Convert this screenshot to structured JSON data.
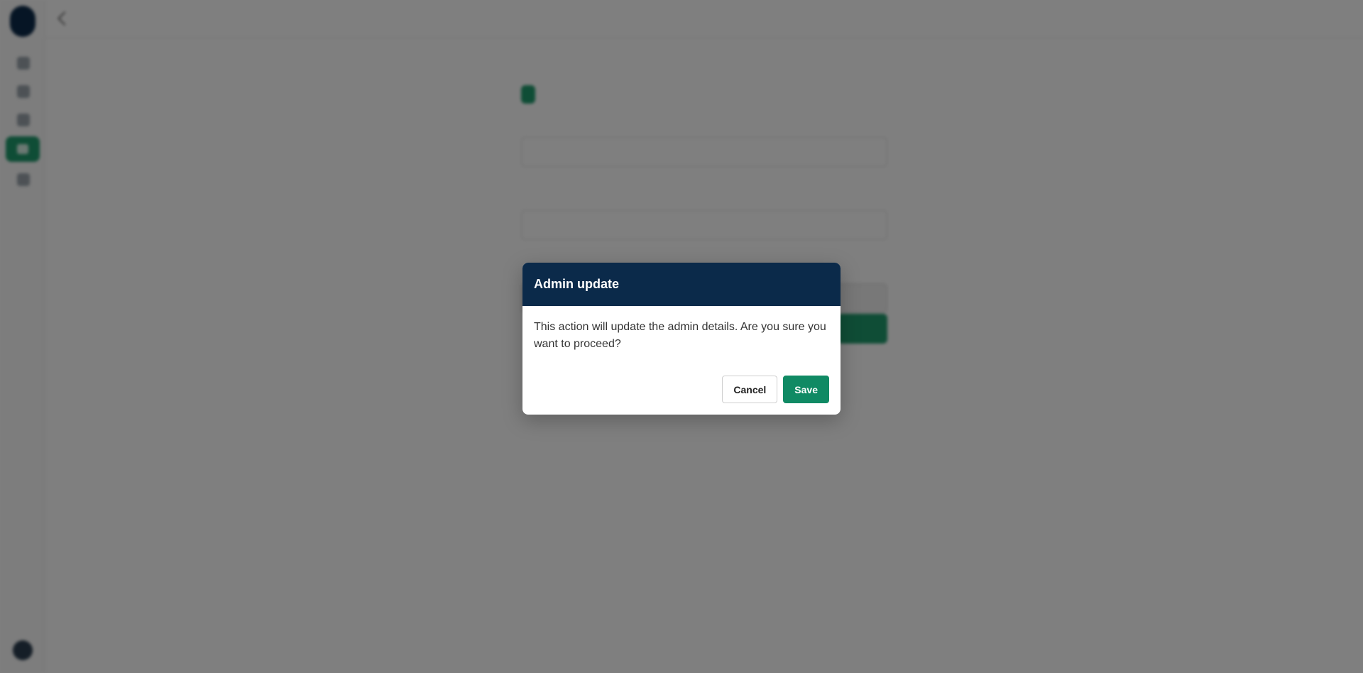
{
  "colors": {
    "modal_header": "#0b2a4a",
    "primary": "#108a64",
    "sidebar_active": "#1f9a6c",
    "overlay": "rgba(0,0,0,0.5)"
  },
  "sidebar": {
    "items": [
      {
        "icon": "home-icon"
      },
      {
        "icon": "grid-icon"
      },
      {
        "icon": "chart-icon"
      },
      {
        "icon": "admin-icon",
        "active": true
      },
      {
        "icon": "settings-icon"
      }
    ],
    "bottom_icon": "user-avatar"
  },
  "modal": {
    "title": "Admin update",
    "message": "This action will update the admin details. Are you sure you want to proceed?",
    "cancel_label": "Cancel",
    "save_label": "Save"
  }
}
